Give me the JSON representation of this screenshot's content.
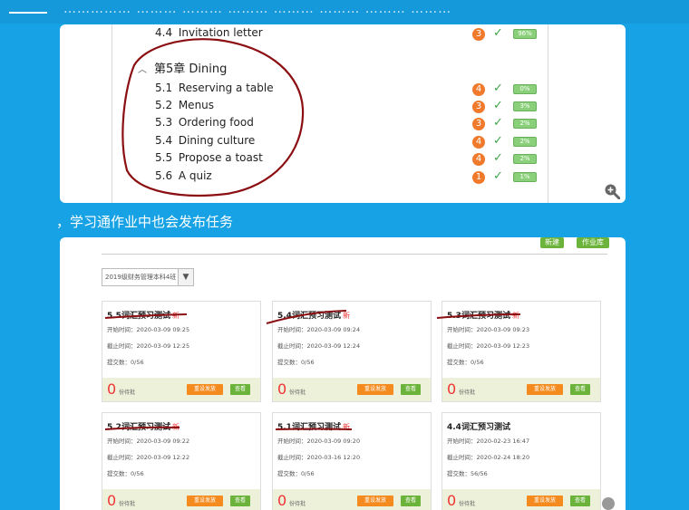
{
  "topbar": {
    "faint_text": "…………… ……… ……… ……… ……… ……… ……… ………"
  },
  "lesson_panel": {
    "prev_item": {
      "num": "4.4",
      "title": "Invitation letter",
      "count": "3",
      "progress": "96%"
    },
    "chapter": {
      "label": "第5章 Dining"
    },
    "items": [
      {
        "num": "5.1",
        "title": "Reserving a table",
        "count": "4",
        "progress": "0%"
      },
      {
        "num": "5.2",
        "title": "Menus",
        "count": "3",
        "progress": "3%"
      },
      {
        "num": "5.3",
        "title": "Ordering food",
        "count": "3",
        "progress": "2%"
      },
      {
        "num": "5.4",
        "title": "Dining culture",
        "count": "4",
        "progress": "2%"
      },
      {
        "num": "5.5",
        "title": "Propose a toast",
        "count": "4",
        "progress": "2%"
      },
      {
        "num": "5.6",
        "title": "A quiz",
        "count": "1",
        "progress": "1%"
      }
    ]
  },
  "caption": "，学习通作业中也会发布任务",
  "homework": {
    "new_btn": "新建",
    "library_btn": "作业库",
    "class_select": "2019级财务管理本科4班",
    "tasks": [
      {
        "title": "5.5词汇预习测试",
        "is_new": "新",
        "start": "开始时间：2020-03-09 09:25",
        "end": "截止时间：2020-03-09 12:25",
        "submitted": "提交数：0/56",
        "pending": "0",
        "pending_label": "份待批",
        "resend": "重设发放",
        "view": "查看"
      },
      {
        "title": "5.4词汇预习测试",
        "is_new": "新",
        "start": "开始时间：2020-03-09 09:24",
        "end": "截止时间：2020-03-09 12:24",
        "submitted": "提交数：0/56",
        "pending": "0",
        "pending_label": "份待批",
        "resend": "重设发放",
        "view": "查看"
      },
      {
        "title": "5.3词汇预习测试",
        "is_new": "新",
        "start": "开始时间：2020-03-09 09:23",
        "end": "截止时间：2020-03-09 12:23",
        "submitted": "提交数：0/56",
        "pending": "0",
        "pending_label": "份待批",
        "resend": "重设发放",
        "view": "查看"
      },
      {
        "title": "5.2词汇预习测试",
        "is_new": "新",
        "start": "开始时间：2020-03-09 09:22",
        "end": "截止时间：2020-03-09 12:22",
        "submitted": "提交数：0/56",
        "pending": "0",
        "pending_label": "份待批",
        "resend": "重设发放",
        "view": "查看"
      },
      {
        "title": "5.1词汇预习测试",
        "is_new": "新",
        "start": "开始时间：2020-03-09 09:20",
        "end": "截止时间：2020-03-16 12:20",
        "submitted": "提交数：0/56",
        "pending": "0",
        "pending_label": "份待批",
        "resend": "重设发放",
        "view": "查看"
      },
      {
        "title": "4.4词汇预习测试",
        "is_new": "",
        "start": "开始时间：2020-02-23 16:47",
        "end": "截止时间：2020-02-24 18:20",
        "submitted": "提交数：56/56",
        "pending": "0",
        "pending_label": "份待批",
        "resend": "重设发放",
        "view": "查看"
      }
    ]
  },
  "colors": {
    "background": "#16a2e4",
    "badge": "#f0792b",
    "check": "#3ea54a",
    "ink": "#8b0f12",
    "orange_btn": "#f58b1f",
    "green_btn": "#6bb33a"
  }
}
